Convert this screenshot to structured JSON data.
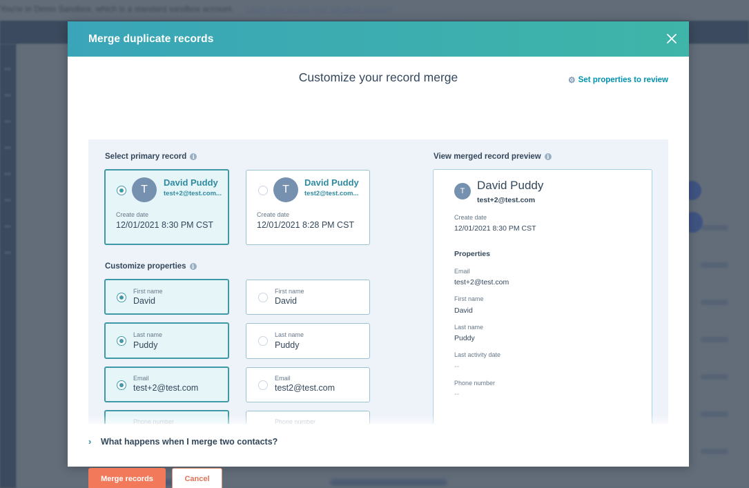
{
  "background": {
    "banner_text": "You're in Demo Sandbox, which is a standard sandbox account.",
    "banner_link": "Learn how to use your sandbox account"
  },
  "modal": {
    "title": "Merge duplicate records",
    "close_icon": "close-icon",
    "subtitle": "Customize your record merge",
    "set_properties_link": "Set properties to review",
    "set_properties_icon": "gear-icon",
    "primary_section": {
      "label": "Select primary record",
      "records": [
        {
          "selected": true,
          "avatar_initial": "T",
          "name": "David Puddy",
          "email": "test+2@test.com...",
          "create_date_label": "Create date",
          "create_date": "12/01/2021 8:30 PM CST"
        },
        {
          "selected": false,
          "avatar_initial": "T",
          "name": "David Puddy",
          "email": "test2@test.com...",
          "create_date_label": "Create date",
          "create_date": "12/01/2021 8:28 PM CST"
        }
      ]
    },
    "properties_section": {
      "label": "Customize properties",
      "rows": [
        {
          "label": "First name",
          "left": "David",
          "right": "David",
          "selected": "left"
        },
        {
          "label": "Last name",
          "left": "Puddy",
          "right": "Puddy",
          "selected": "left"
        },
        {
          "label": "Email",
          "left": "test+2@test.com",
          "right": "test2@test.com",
          "selected": "left"
        },
        {
          "label": "Phone number",
          "left": "",
          "right": "",
          "selected": "left"
        }
      ]
    },
    "preview": {
      "label": "View merged record preview",
      "avatar_initial": "T",
      "name": "David Puddy",
      "email": "test+2@test.com",
      "create_date_label": "Create date",
      "create_date": "12/01/2021 8:30 PM CST",
      "properties_heading": "Properties",
      "properties": [
        {
          "label": "Email",
          "value": "test+2@test.com"
        },
        {
          "label": "First name",
          "value": "David"
        },
        {
          "label": "Last name",
          "value": "Puddy"
        },
        {
          "label": "Last activity date",
          "value": "--"
        },
        {
          "label": "Phone number",
          "value": "--"
        }
      ]
    },
    "faq": {
      "chevron_icon": "chevron-right-icon",
      "text": "What happens when I merge two contacts?"
    },
    "buttons": {
      "merge": "Merge records",
      "cancel": "Cancel"
    }
  },
  "colors": {
    "header_gradient_start": "#3aa5b8",
    "header_gradient_end": "#3eb5a8",
    "primary_button": "#f2795a",
    "link": "#0091ae",
    "selected_card_bg": "#e5f5f8",
    "selected_card_border": "#3f98a6"
  }
}
